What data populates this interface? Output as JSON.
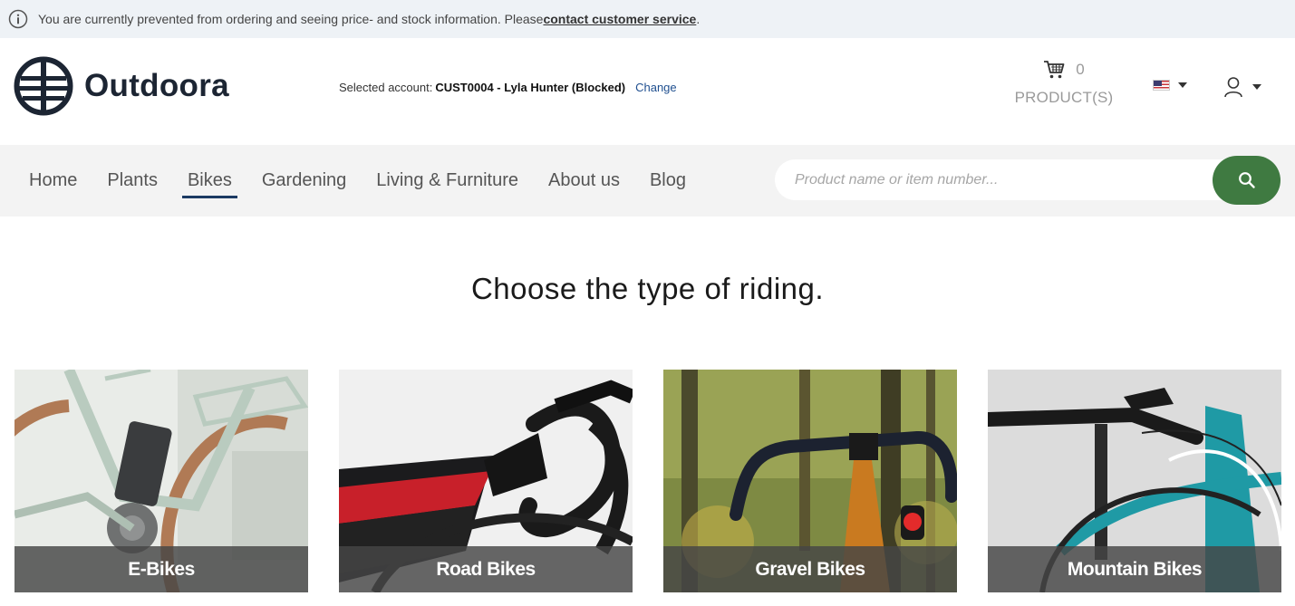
{
  "notice": {
    "text": "You are currently prevented from ordering and seeing price- and stock information. Please ",
    "link": "contact customer service",
    "suffix": "."
  },
  "header": {
    "brand": "Outdoora",
    "account_label": "Selected account:",
    "account_value": "CUST0004 - Lyla Hunter (Blocked)",
    "change_label": "Change",
    "cart_count": "0",
    "cart_label": "PRODUCT(S)"
  },
  "nav": {
    "items": [
      {
        "label": "Home"
      },
      {
        "label": "Plants"
      },
      {
        "label": "Bikes",
        "active": true
      },
      {
        "label": "Gardening"
      },
      {
        "label": "Living & Furniture"
      },
      {
        "label": "About us"
      },
      {
        "label": "Blog"
      }
    ],
    "search_placeholder": "Product name or item number..."
  },
  "main": {
    "heading": "Choose the type of riding.",
    "categories": [
      {
        "label": "E-Bikes"
      },
      {
        "label": "Road Bikes"
      },
      {
        "label": "Gravel Bikes"
      },
      {
        "label": "Mountain Bikes"
      }
    ]
  },
  "colors": {
    "accent_green": "#3f7a41",
    "nav_active": "#1b3a63",
    "brand_dark": "#1c2533",
    "notice_bg": "#eef2f6"
  },
  "icons": [
    "info-icon",
    "logo-icon",
    "cart-icon",
    "flag-us-icon",
    "user-icon",
    "search-icon",
    "chevron-down-icon"
  ]
}
